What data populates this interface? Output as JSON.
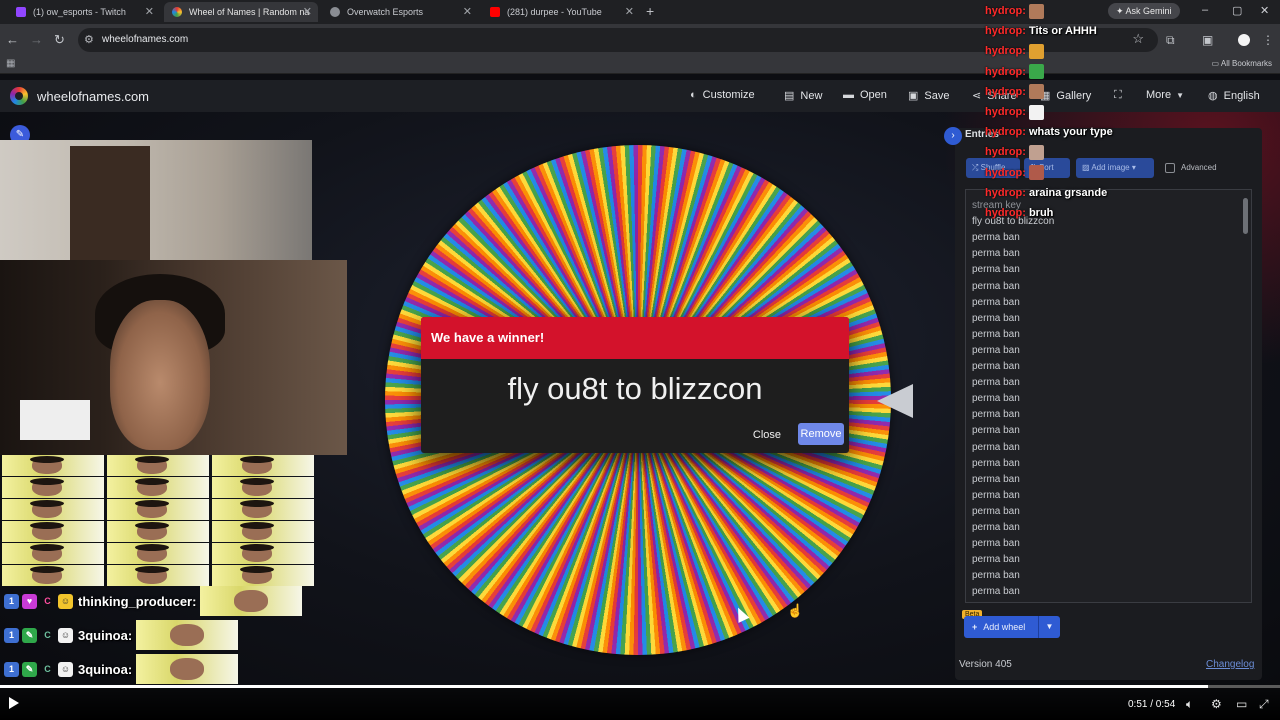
{
  "browser": {
    "tabs": [
      {
        "label": "(1) ow_esports - Twitch",
        "color": "#9146ff",
        "active": false
      },
      {
        "label": "Wheel of Names | Random nam",
        "color": "#4285f4",
        "active": true
      },
      {
        "label": "Overwatch Esports",
        "color": "#8a8d93",
        "active": false
      },
      {
        "label": "(281) durpee - YouTube",
        "color": "#ff0000",
        "active": false
      }
    ],
    "url": "wheelofnames.com",
    "ask_gemini": "Ask Gemini",
    "all_bookmarks": "All Bookmarks"
  },
  "site": {
    "name": "wheelofnames.com",
    "menu": {
      "customize": "Customize",
      "new": "New",
      "open": "Open",
      "save": "Save",
      "share": "Share",
      "gallery": "Gallery",
      "more": "More",
      "language": "English"
    }
  },
  "dialog": {
    "title": "We have a winner!",
    "winner": "fly ou8t to blizzcon",
    "close": "Close",
    "remove": "Remove"
  },
  "panel": {
    "entries_tab": "Entries",
    "shuffle": "Shuffle",
    "sort": "Sort",
    "add_image": "Add image",
    "advanced": "Advanced",
    "entries": [
      "stream key",
      "fly ou8t to blizzcon",
      "perma ban",
      "perma ban",
      "perma ban",
      "perma ban",
      "perma ban",
      "perma ban",
      "perma ban",
      "perma ban",
      "perma ban",
      "perma ban",
      "perma ban",
      "perma ban",
      "perma ban",
      "perma ban",
      "perma ban",
      "perma ban",
      "perma ban",
      "perma ban",
      "perma ban",
      "perma ban",
      "perma ban",
      "perma ban",
      "perma ban",
      "perma ban"
    ],
    "beta": "Beta",
    "add_wheel": "Add wheel",
    "version": "Version 405",
    "changelog": "Changelog"
  },
  "chat_left": [
    {
      "user": "thinking_producer:"
    },
    {
      "user": "3quinoa:"
    },
    {
      "user": "3quinoa:"
    },
    {
      "user": "3quinoa:"
    }
  ],
  "chat_right": [
    {
      "user": "hydrop:",
      "message": "",
      "emote_color": "#b07a5a"
    },
    {
      "user": "hydrop:",
      "message": "Tits or AHHH",
      "emote_color": ""
    },
    {
      "user": "hydrop:",
      "message": "",
      "emote_color": "#e0a030"
    },
    {
      "user": "hydrop:",
      "message": "",
      "emote_color": "#3aa84a"
    },
    {
      "user": "hydrop:",
      "message": "",
      "emote_color": "#b07a5a"
    },
    {
      "user": "hydrop:",
      "message": "",
      "emote_color": "#f2f2f2"
    },
    {
      "user": "hydrop:",
      "message": "whats your type",
      "emote_color": ""
    },
    {
      "user": "hydrop:",
      "message": "",
      "emote_color": "#c0a090"
    },
    {
      "user": "hydrop:",
      "message": "",
      "emote_color": "#b05a4a"
    },
    {
      "user": "hydrop:",
      "message": "araina grsande",
      "emote_color": ""
    },
    {
      "user": "hydrop:",
      "message": "bruh",
      "emote_color": ""
    }
  ],
  "player": {
    "time": "0:51 / 0:54",
    "progress": 0.944
  }
}
